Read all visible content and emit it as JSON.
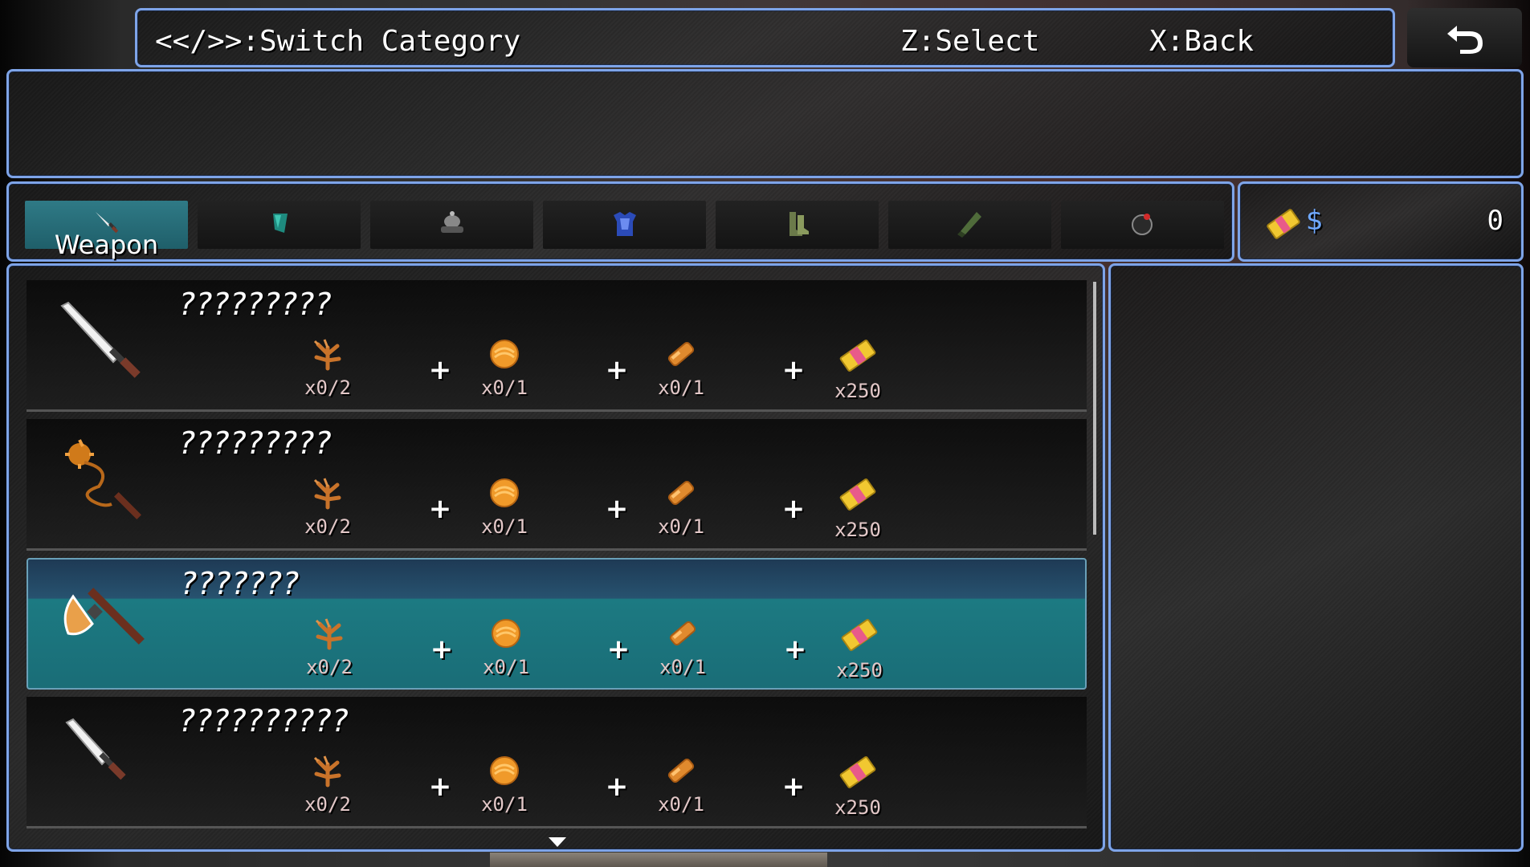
{
  "help": {
    "switch_category": "<</>>:Switch Category",
    "select": "Z:Select",
    "back": "X:Back"
  },
  "back_button": {
    "icon": "return-arrow-icon"
  },
  "categories": [
    {
      "label": "Weapon",
      "icon": "sword-icon",
      "active": true
    },
    {
      "label": "",
      "icon": "shield-icon",
      "active": false
    },
    {
      "label": "",
      "icon": "helmet-icon",
      "active": false
    },
    {
      "label": "",
      "icon": "armor-icon",
      "active": false
    },
    {
      "label": "",
      "icon": "boots-icon",
      "active": false
    },
    {
      "label": "",
      "icon": "gauntlet-icon",
      "active": false
    },
    {
      "label": "",
      "icon": "bomb-icon",
      "active": false
    }
  ],
  "gold": {
    "currency_symbol": "$",
    "amount": "0",
    "icon": "money-bill-icon"
  },
  "recipes": [
    {
      "name": "?????????",
      "icon": "sword-icon",
      "selected": false,
      "ingredients": [
        {
          "icon": "branch-icon",
          "count": "x0/2"
        },
        {
          "icon": "orb-icon",
          "count": "x0/1"
        },
        {
          "icon": "ingot-icon",
          "count": "x0/1"
        },
        {
          "icon": "money-bill-icon",
          "count": "x250"
        }
      ]
    },
    {
      "name": "?????????",
      "icon": "flail-icon",
      "selected": false,
      "ingredients": [
        {
          "icon": "branch-icon",
          "count": "x0/2"
        },
        {
          "icon": "orb-icon",
          "count": "x0/1"
        },
        {
          "icon": "ingot-icon",
          "count": "x0/1"
        },
        {
          "icon": "money-bill-icon",
          "count": "x250"
        }
      ]
    },
    {
      "name": "???????",
      "icon": "axe-icon",
      "selected": true,
      "ingredients": [
        {
          "icon": "branch-icon",
          "count": "x0/2"
        },
        {
          "icon": "orb-icon",
          "count": "x0/1"
        },
        {
          "icon": "ingot-icon",
          "count": "x0/1"
        },
        {
          "icon": "money-bill-icon",
          "count": "x250"
        }
      ]
    },
    {
      "name": "??????????",
      "icon": "dagger-icon",
      "selected": false,
      "ingredients": [
        {
          "icon": "branch-icon",
          "count": "x0/2"
        },
        {
          "icon": "orb-icon",
          "count": "x0/1"
        },
        {
          "icon": "ingot-icon",
          "count": "x0/1"
        },
        {
          "icon": "money-bill-icon",
          "count": "x250"
        }
      ]
    }
  ],
  "plus_sign": "+",
  "colors": {
    "window_border": "#7ea4e8",
    "selected_row": "#1a6d77",
    "currency": "#6fa8ff"
  }
}
